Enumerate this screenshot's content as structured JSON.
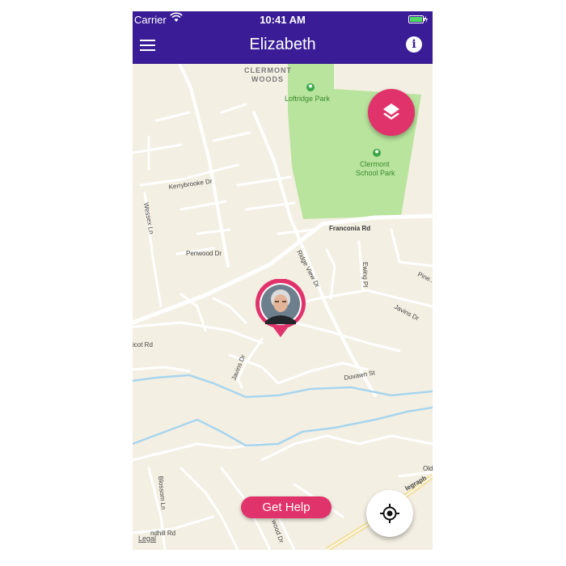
{
  "status_bar": {
    "carrier": "Carrier",
    "time": "10:41 AM"
  },
  "nav": {
    "title": "Elizabeth",
    "info_glyph": "i"
  },
  "map": {
    "areas": {
      "neighborhood_line1": "CLERMONT",
      "neighborhood_line2": "WOODS"
    },
    "parks": {
      "loftridge": "Loftridge Park",
      "clermont_line1": "Clermont",
      "clermont_line2": "School Park"
    },
    "streets": {
      "kerrybrooke": "Kerrybrooke Dr",
      "wessex": "Wessex Ln",
      "penwood": "Penwood Dr",
      "franconia": "Franconia Rd",
      "ridge_view": "Ridge View Dr",
      "ewing": "Ewing Pl",
      "pine": "Pine...",
      "javins_east": "Javins Dr",
      "javins_west": "Javins Dr",
      "duvawn": "Duvawn St",
      "icot": "icot Rd",
      "blossom": "Blossom Ln",
      "dhill": "ndhill Rd",
      "wood": "wood Dr",
      "old": "Old",
      "telegraph": "legraph"
    },
    "legal": "Legal",
    "colors": {
      "land": "#f4efe3",
      "park": "#b8e49d",
      "water": "#a7d5ee",
      "road": "#ffffff",
      "highway": "#f3e0a0"
    }
  },
  "buttons": {
    "get_help": "Get Help"
  },
  "icons": {
    "menu": "hamburger-menu-icon",
    "info": "info-icon",
    "wifi": "wifi-icon",
    "battery": "battery-charging-icon",
    "layers": "layers-icon",
    "locate": "crosshair-location-icon",
    "park_marker": "park-marker-icon",
    "avatar": "user-photo-avatar"
  },
  "colors": {
    "header": "#3a1d96",
    "accent": "#e0336b"
  }
}
